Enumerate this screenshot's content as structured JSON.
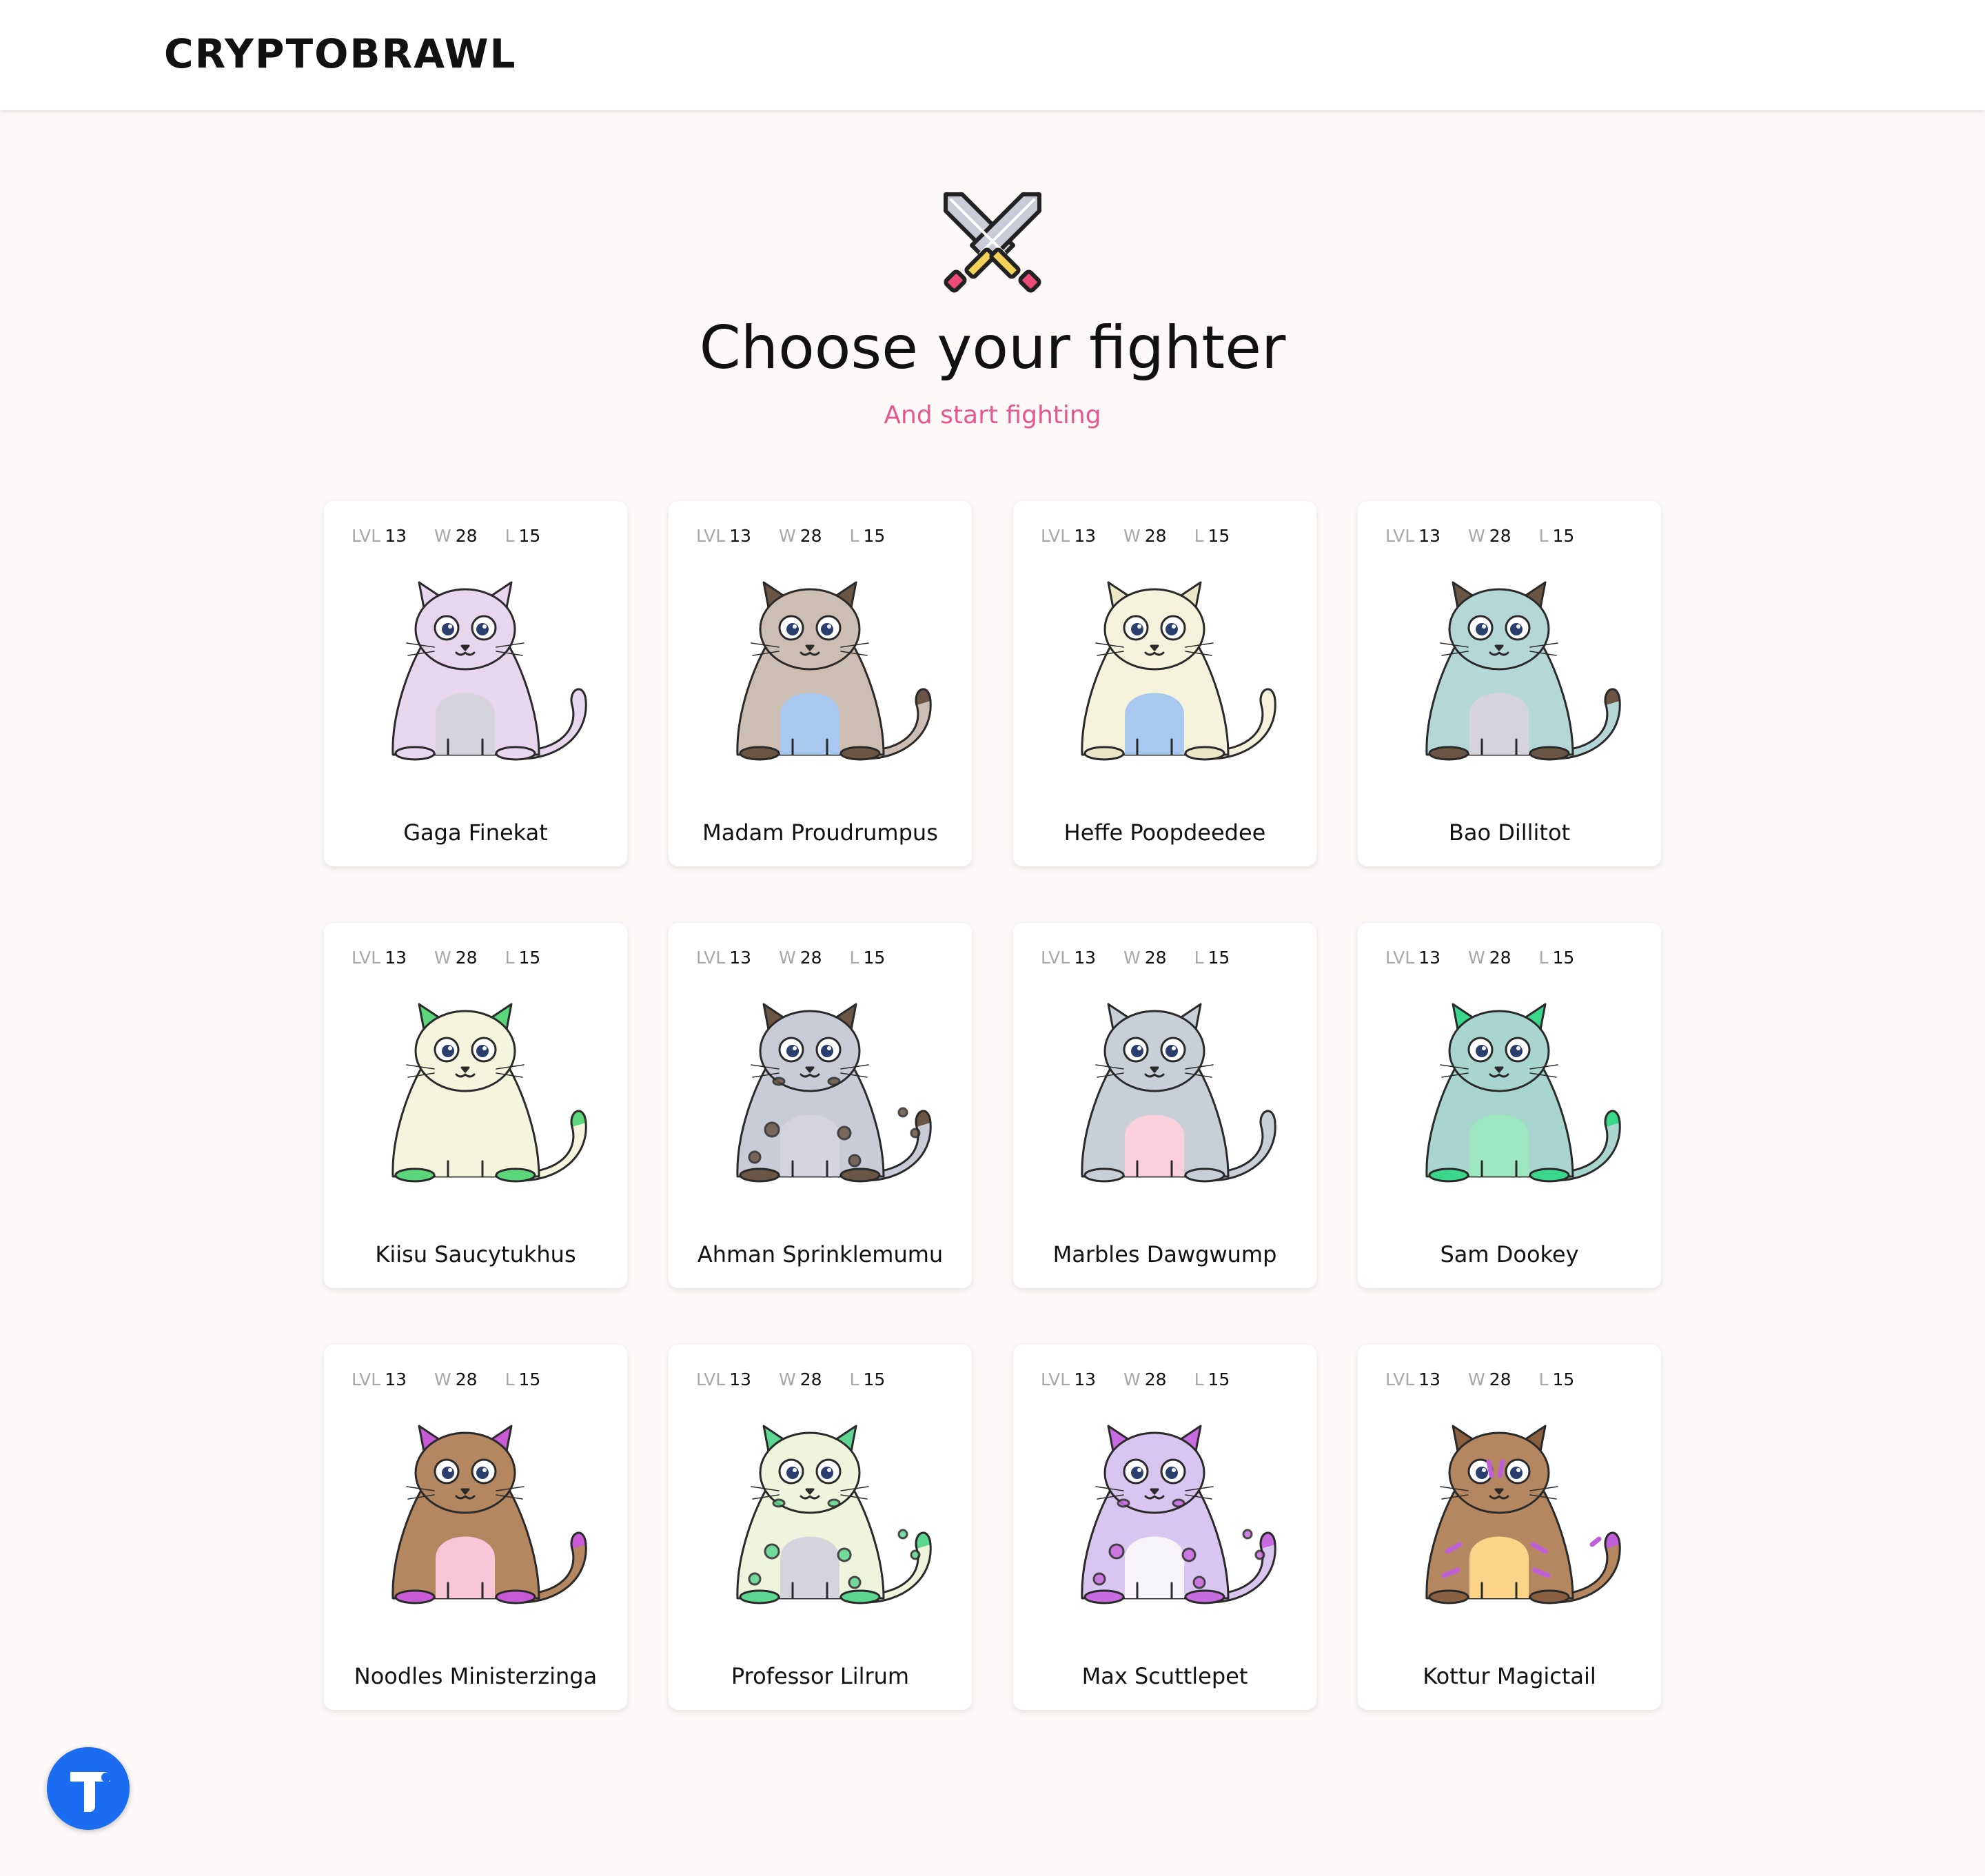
{
  "header": {
    "logo": "CRYPTOBRAWL"
  },
  "hero": {
    "icon": "crossed-swords-icon",
    "title": "Choose your fighter",
    "subtitle": "And start fighting",
    "subtitle_color": "#e5578f"
  },
  "labels": {
    "level": "LVL",
    "wins": "W",
    "losses": "L"
  },
  "fighters": [
    {
      "name": "Gaga Finekat",
      "level": "13",
      "wins": "28",
      "losses": "15",
      "body": "#e8d5ee",
      "belly": "#d5d3dc",
      "accent": "#e8d5ee",
      "ears": "#e8d5ee",
      "pattern": "none"
    },
    {
      "name": "Madam Proudrumpus",
      "level": "13",
      "wins": "28",
      "losses": "15",
      "body": "#cdbeb3",
      "belly": "#a8c8f0",
      "accent": "#6b5545",
      "ears": "#6b5545",
      "pattern": "none"
    },
    {
      "name": "Heffe Poopdeedee",
      "level": "13",
      "wins": "28",
      "losses": "15",
      "body": "#f5f3dc",
      "belly": "#a8c8f0",
      "accent": "#f5f3dc",
      "ears": "#ebe6c6",
      "pattern": "none"
    },
    {
      "name": "Bao Dillitot",
      "level": "13",
      "wins": "28",
      "losses": "15",
      "body": "#b5d8d6",
      "belly": "#d5d3dc",
      "accent": "#6b5545",
      "ears": "#6b5545",
      "pattern": "none"
    },
    {
      "name": "Kiisu Saucytukhus",
      "level": "13",
      "wins": "28",
      "losses": "15",
      "body": "#f4f5dc",
      "belly": "#f4f5dc",
      "accent": "#5cd67a",
      "ears": "#5cd67a",
      "pattern": "none"
    },
    {
      "name": "Ahman Sprinklemumu",
      "level": "13",
      "wins": "28",
      "losses": "15",
      "body": "#c9ccd6",
      "belly": "#d5d3dc",
      "accent": "#6b5545",
      "ears": "#6b5545",
      "pattern": "spots"
    },
    {
      "name": "Marbles Dawgwump",
      "level": "13",
      "wins": "28",
      "losses": "15",
      "body": "#c8cfd6",
      "belly": "#fad0dc",
      "accent": "#c8cfd6",
      "ears": "#c8cfd6",
      "pattern": "none"
    },
    {
      "name": "Sam Dookey",
      "level": "13",
      "wins": "28",
      "losses": "15",
      "body": "#a8d6ce",
      "belly": "#9de8c0",
      "accent": "#3ad68a",
      "ears": "#3ad68a",
      "pattern": "none"
    },
    {
      "name": "Noodles Ministerzinga",
      "level": "13",
      "wins": "28",
      "losses": "15",
      "body": "#b58760",
      "belly": "#f8c6d6",
      "accent": "#c85ad6",
      "ears": "#c85ad6",
      "pattern": "none"
    },
    {
      "name": "Professor Lilrum",
      "level": "13",
      "wins": "28",
      "losses": "15",
      "body": "#eef5dc",
      "belly": "#d5d3dc",
      "accent": "#5cd690",
      "ears": "#5cd690",
      "pattern": "spots"
    },
    {
      "name": "Max Scuttlepet",
      "level": "13",
      "wins": "28",
      "losses": "15",
      "body": "#d9c6f0",
      "belly": "#f6f4f8",
      "accent": "#c86ae0",
      "ears": "#c86ae0",
      "pattern": "spots"
    },
    {
      "name": "Kottur Magictail",
      "level": "13",
      "wins": "28",
      "losses": "15",
      "body": "#b58760",
      "belly": "#fbd48a",
      "accent": "#c060d8",
      "ears": "#8a6040",
      "pattern": "stripes"
    }
  ],
  "fab": {
    "icon": "t-logo-icon",
    "color": "#1a6cf0"
  }
}
